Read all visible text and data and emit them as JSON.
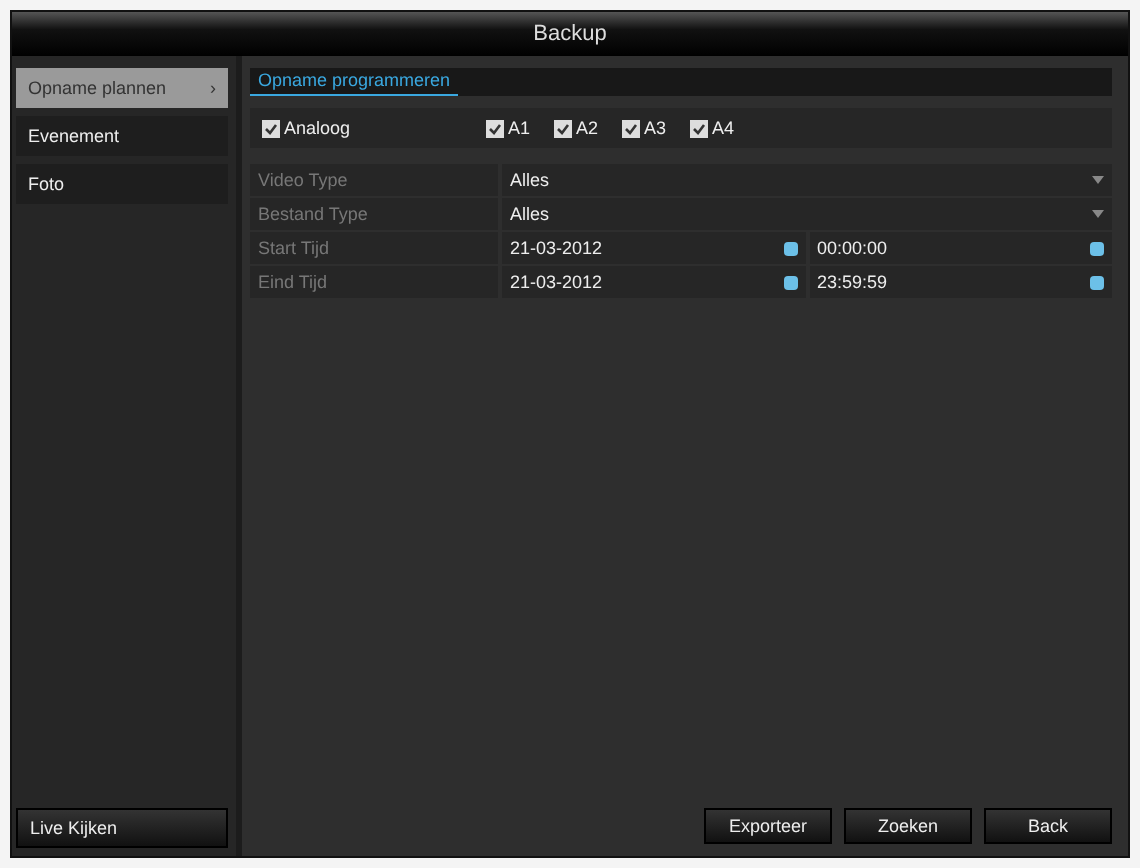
{
  "window": {
    "title": "Backup"
  },
  "sidebar": {
    "items": [
      {
        "label": "Opname plannen",
        "selected": true,
        "arrow": "›"
      },
      {
        "label": "Evenement",
        "selected": false
      },
      {
        "label": "Foto",
        "selected": false
      }
    ],
    "bottom_button": "Live Kijken"
  },
  "tabs": [
    {
      "label": "Opname programmeren",
      "selected": true
    }
  ],
  "channels": {
    "group": {
      "label": "Analoog",
      "checked": true
    },
    "items": [
      {
        "label": "A1",
        "checked": true
      },
      {
        "label": "A2",
        "checked": true
      },
      {
        "label": "A3",
        "checked": true
      },
      {
        "label": "A4",
        "checked": true
      }
    ]
  },
  "fields": [
    {
      "kind": "select",
      "label": "Video Type",
      "value": "Alles"
    },
    {
      "kind": "select",
      "label": "Bestand Type",
      "value": "Alles"
    },
    {
      "kind": "datetime",
      "label": "Start Tijd",
      "date": "21-03-2012",
      "time": "00:00:00"
    },
    {
      "kind": "datetime",
      "label": "Eind Tijd",
      "date": "21-03-2012",
      "time": "23:59:59"
    }
  ],
  "buttons": [
    "Exporteer",
    "Zoeken",
    "Back"
  ]
}
